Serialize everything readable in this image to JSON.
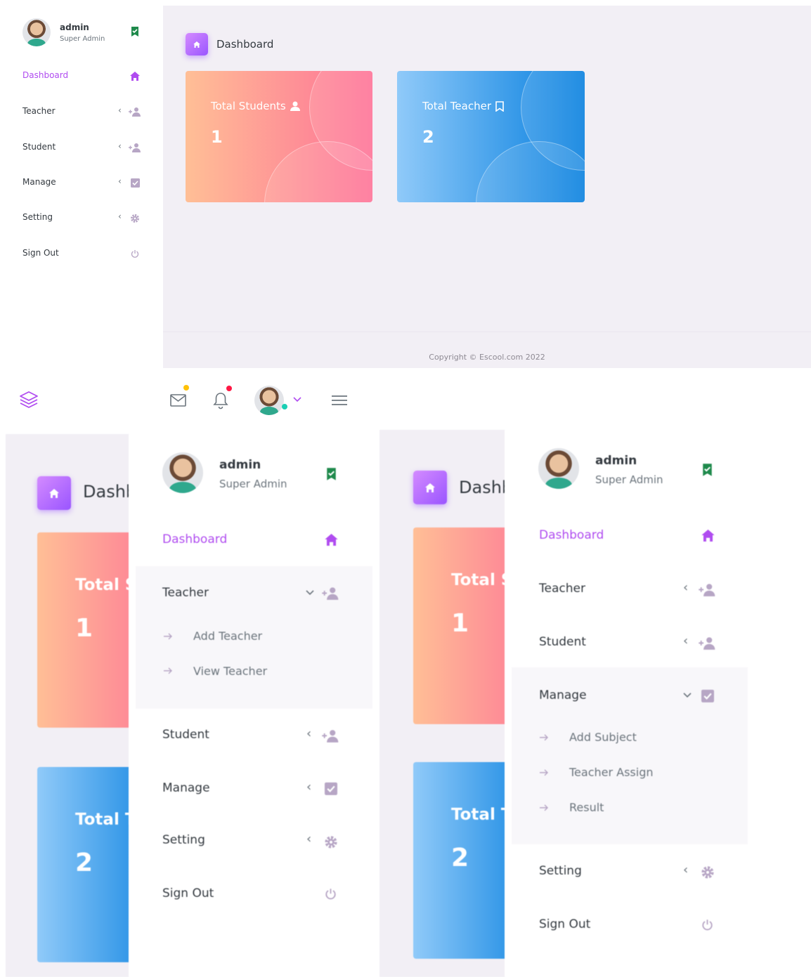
{
  "profile": {
    "name": "admin",
    "role": "Super Admin"
  },
  "menu": {
    "dashboard": "Dashboard",
    "teacher": "Teacher",
    "student": "Student",
    "manage": "Manage",
    "setting": "Setting",
    "signout": "Sign Out"
  },
  "teacher_submenu": [
    "Add Teacher",
    "View Teacher"
  ],
  "manage_submenu": [
    "Add Subject",
    "Teacher Assign",
    "Result"
  ],
  "breadcrumb": {
    "title": "Dashboard",
    "cropped_title": "Dashb"
  },
  "cards": {
    "students": {
      "title": "Total Students",
      "cropped_title": "Total S",
      "value": "1"
    },
    "teachers": {
      "title": "Total Teacher",
      "cropped_title": "Total T",
      "value": "2"
    }
  },
  "footer": {
    "copyright": "Copyright © Escool.com 2022"
  },
  "colors": {
    "accent": "#b04cf0",
    "card_red_start": "#ffbf96",
    "card_red_end": "#fe7096",
    "card_blue_start": "#90caf9",
    "card_blue_end": "#047edf",
    "mail_badge": "#ffc107",
    "bell_badge": "#ff1744",
    "online_dot": "#1bcfb4"
  },
  "icons": [
    "verified-icon",
    "home-icon",
    "user-plus-icon",
    "check-square-icon",
    "gear-icon",
    "power-icon",
    "user-icon",
    "bookmark-icon",
    "layers-icon",
    "mail-icon",
    "bell-icon",
    "chevron-left-icon",
    "chevron-down-icon",
    "menu-icon",
    "arrow-right-icon"
  ]
}
